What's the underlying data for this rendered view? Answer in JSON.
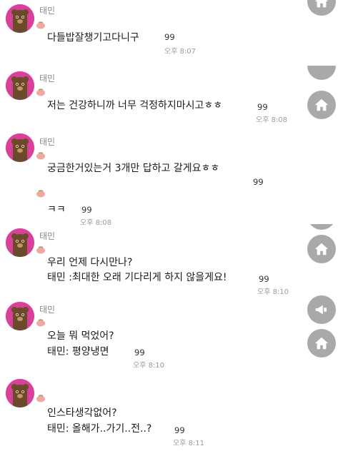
{
  "sender_name": "태민",
  "messages": [
    {
      "text": "다들밥잘챙기고다니구",
      "unread": "99",
      "time": "오후 8:07"
    },
    {
      "text": "저는 건강하니까 너무 걱정하지마시고ㅎㅎ",
      "unread": "99",
      "time": "오후 8:08"
    },
    {
      "text": "궁금한거있는거 3개만 답하고 갈게요ㅎㅎ",
      "unread": "99"
    },
    {
      "text": "ㅋㅋ",
      "unread": "99",
      "time": "오후 8:08"
    },
    {
      "line1": "우리 언제 다시만나?",
      "line2": "태민 :최대한 오래 기다리게 하지 않을게요!",
      "unread": "99",
      "time": "오후 8:10"
    },
    {
      "line1": "오늘 뭐 먹었어?",
      "line2": "태민: 평양냉면",
      "unread": "99",
      "time": "오후 8:10"
    },
    {
      "line1": "인스타생각없어?",
      "line2": "태민: 올해가..가기..전..?",
      "unread": "99",
      "time": "오후 8:11"
    }
  ],
  "icons": {
    "home": "home-icon",
    "megaphone": "megaphone-icon",
    "avatar": "bear-avatar-icon",
    "badge": "peach-badge-icon"
  },
  "colors": {
    "avatar_bg": "#d9409a",
    "button_bg": "#a9a9a9",
    "badge": "#f4a7a0"
  }
}
